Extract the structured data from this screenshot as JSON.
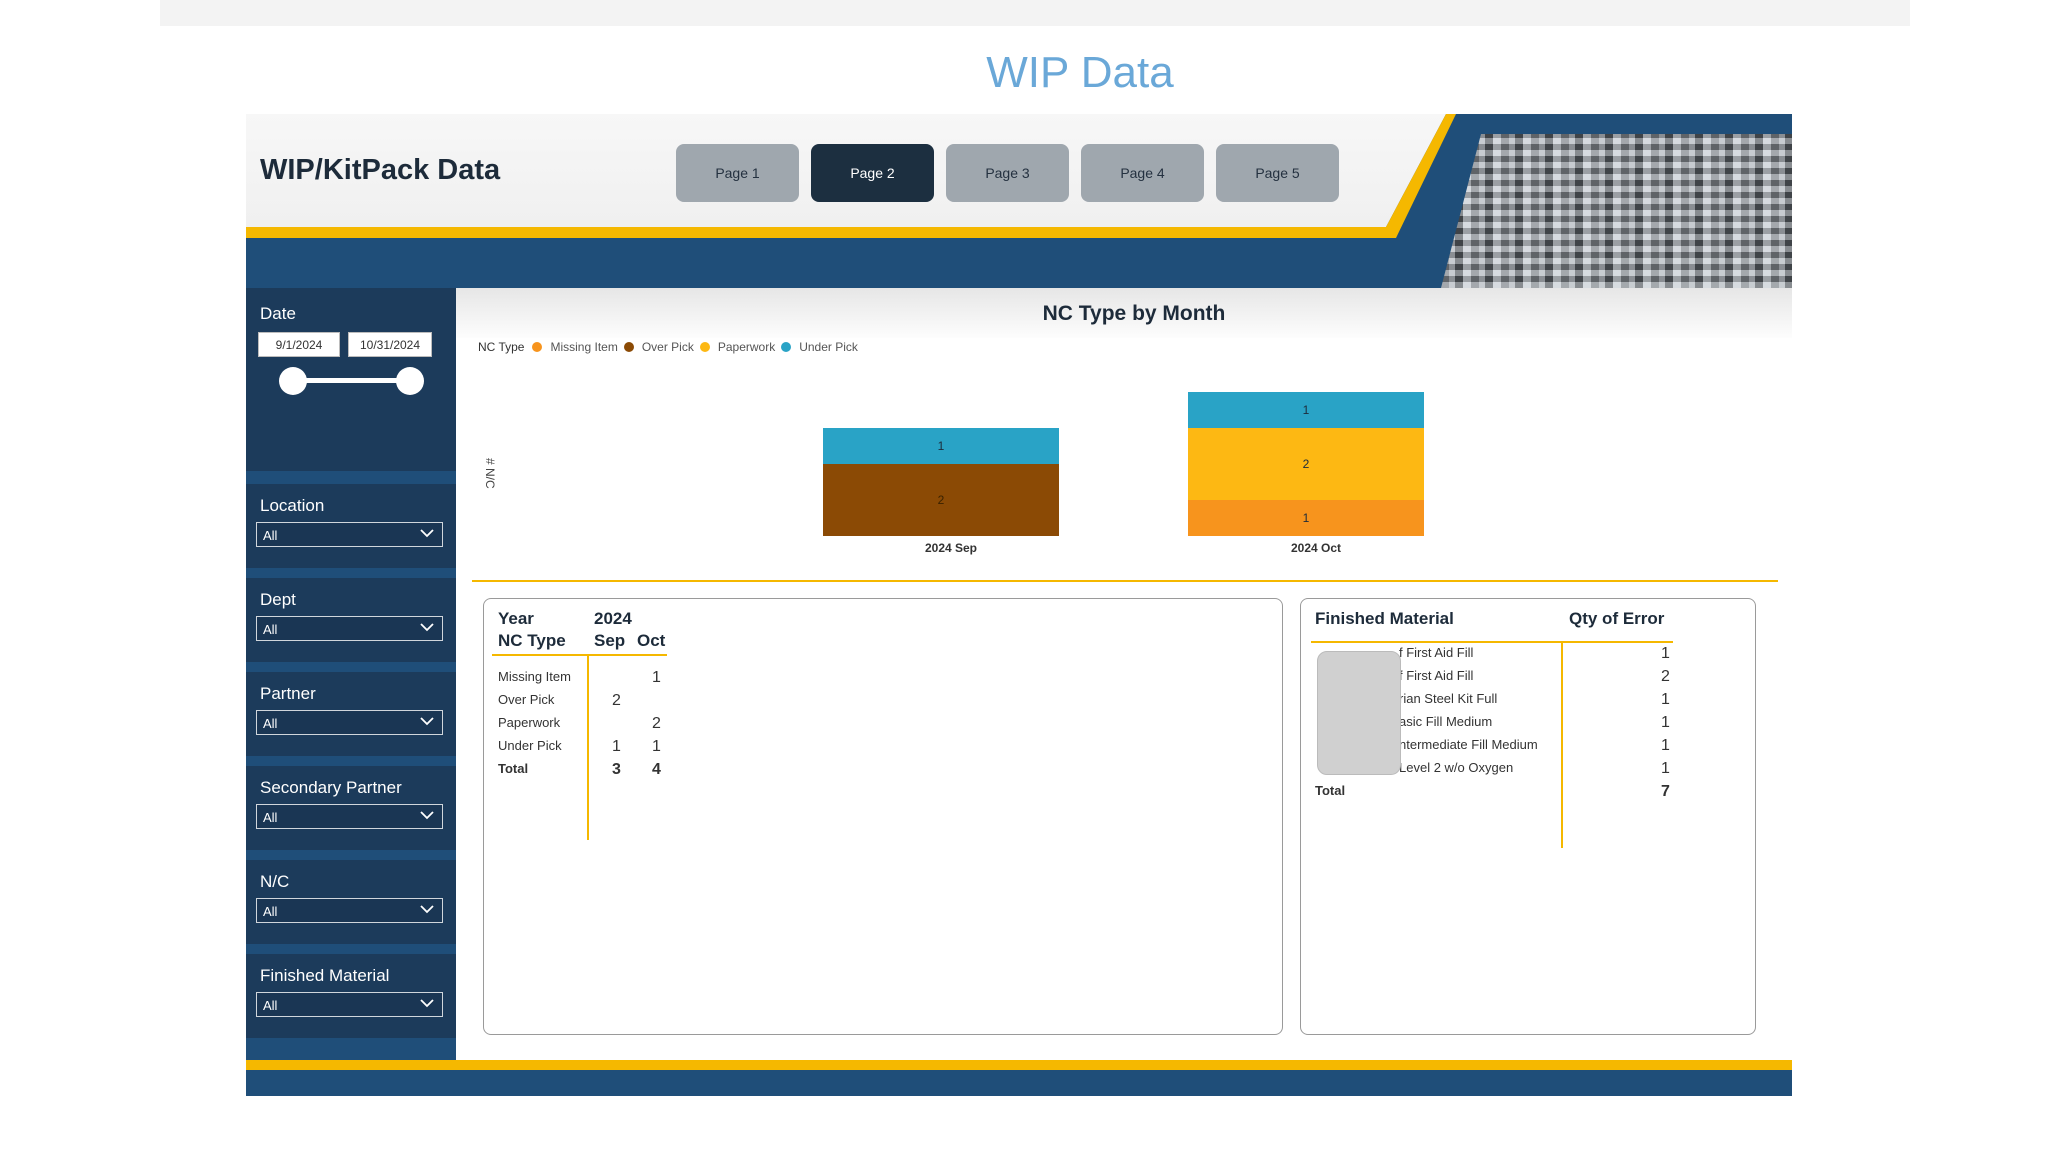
{
  "page": {
    "title": "WIP Data"
  },
  "header": {
    "report_title": "WIP/KitPack Data",
    "tabs": [
      {
        "label": "Page 1",
        "active": false
      },
      {
        "label": "Page 2",
        "active": true
      },
      {
        "label": "Page 3",
        "active": false
      },
      {
        "label": "Page 4",
        "active": false
      },
      {
        "label": "Page 5",
        "active": false
      }
    ]
  },
  "filters": {
    "date": {
      "label": "Date",
      "start": "9/1/2024",
      "end": "10/31/2024"
    },
    "location": {
      "label": "Location",
      "value": "All"
    },
    "dept": {
      "label": "Dept",
      "value": "All"
    },
    "partner": {
      "label": "Partner",
      "value": "All"
    },
    "secondary_partner": {
      "label": "Secondary Partner",
      "value": "All"
    },
    "nc": {
      "label": "N/C",
      "value": "All"
    },
    "finished_material": {
      "label": "Finished Material",
      "value": "All"
    }
  },
  "chart_data": {
    "type": "bar",
    "stacked": true,
    "title": "NC Type by Month",
    "ylabel": "# N/C",
    "xlabel": "",
    "legend_title": "NC Type",
    "legend_position": "top-left",
    "categories": [
      "2024 Sep",
      "2024 Oct"
    ],
    "series": [
      {
        "name": "Missing Item",
        "color": "#f7941d",
        "values": [
          0,
          1
        ]
      },
      {
        "name": "Over Pick",
        "color": "#8b4a05",
        "values": [
          2,
          0
        ]
      },
      {
        "name": "Paperwork",
        "color": "#fdb813",
        "values": [
          0,
          2
        ]
      },
      {
        "name": "Under Pick",
        "color": "#29a3c6",
        "values": [
          1,
          1
        ]
      }
    ],
    "ylim": [
      0,
      4
    ]
  },
  "nc_matrix": {
    "year_label": "Year",
    "year_value": "2024",
    "row_header": "NC Type",
    "months": [
      "Sep",
      "Oct"
    ],
    "rows": [
      {
        "label": "Missing Item",
        "sep": "",
        "oct": "1"
      },
      {
        "label": "Over Pick",
        "sep": "2",
        "oct": ""
      },
      {
        "label": "Paperwork",
        "sep": "",
        "oct": "2"
      },
      {
        "label": "Under Pick",
        "sep": "1",
        "oct": "1"
      }
    ],
    "total": {
      "label": "Total",
      "sep": "3",
      "oct": "4"
    }
  },
  "material_table": {
    "col1": "Finished Material",
    "col2": "Qty of Error",
    "rows": [
      {
        "label": "f First Aid Fill",
        "qty": "1"
      },
      {
        "label": "f First Aid Fill",
        "qty": "2"
      },
      {
        "label": "rian Steel Kit Full",
        "qty": "1"
      },
      {
        "label": "asic Fill Medium",
        "qty": "1"
      },
      {
        "label": "ntermediate Fill Medium",
        "qty": "1"
      },
      {
        "label": "Level 2 w/o Oxygen",
        "qty": "1"
      }
    ],
    "total": {
      "label": "Total",
      "qty": "7"
    }
  }
}
